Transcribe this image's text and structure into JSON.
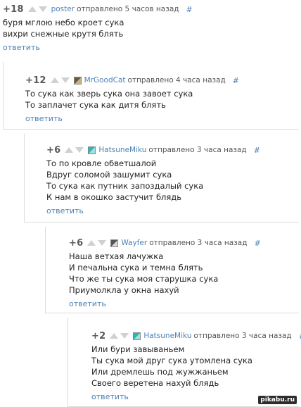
{
  "comments": [
    {
      "rating": "+18",
      "username": "poster",
      "meta": "отправлено 5 часов назад",
      "hash": "#",
      "lines": [
        "буря мглою небо кроет сука",
        "вихри снежные крутя блять"
      ],
      "reply": "ответить"
    },
    {
      "rating": "+12",
      "username": "MrGoodCat",
      "meta": "отправлено 4 часа назад",
      "hash": "#",
      "lines": [
        "То сука как зверь сука она завоет сука",
        "То заплачет сука как дитя блять"
      ],
      "reply": "ответить"
    },
    {
      "rating": "+6",
      "username": "HatsuneMiku",
      "meta": "отправлено 3 часа назад",
      "hash": "#",
      "lines": [
        "То по кровле обветшалой",
        "Вдруг соломой зашумит сука",
        "То сука как путник запоздалый сука",
        "К нам в окошко застучит блядь"
      ],
      "reply": "ответить"
    },
    {
      "rating": "+6",
      "username": "Wayfer",
      "meta": "отправлено 3 часа назад",
      "hash": "#",
      "lines": [
        "Наша ветхая лачужка",
        "И печальна сука и темна блять",
        "Что же ты сука моя старушка сука",
        "Приумолкла у окна нахуй"
      ],
      "reply": "ответить"
    },
    {
      "rating": "+2",
      "username": "HatsuneMiku",
      "meta": "отправлено 3 часа назад",
      "hash": "#",
      "lines": [
        "Или бури завываньем",
        "Ты сука мой друг сука утомлена сука",
        "Или дремлешь под жужжаньем",
        "Своего веретена нахуй блядь"
      ],
      "reply": "ответить"
    }
  ],
  "watermark": "pikabu.ru"
}
